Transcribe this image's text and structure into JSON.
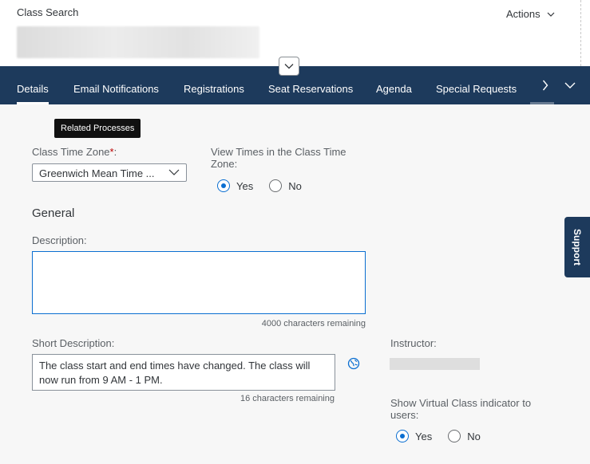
{
  "header": {
    "breadcrumb": "Class Search",
    "actions_label": "Actions"
  },
  "tabs": [
    {
      "label": "Details",
      "active": true
    },
    {
      "label": "Email Notifications"
    },
    {
      "label": "Registrations"
    },
    {
      "label": "Seat Reservations"
    },
    {
      "label": "Agenda"
    },
    {
      "label": "Special Requests"
    }
  ],
  "tooltip": "Related Processes",
  "form": {
    "time_zone": {
      "label": "Class Time Zone",
      "required_mark": "*",
      "colon": ":",
      "value": "Greenwich Mean Time ..."
    },
    "view_times": {
      "label": "View Times in the Class Time Zone:",
      "options": [
        "Yes",
        "No"
      ],
      "selected": "Yes"
    },
    "general_heading": "General",
    "description": {
      "label": "Description:",
      "value": "",
      "counter": "4000 characters remaining"
    },
    "short_description": {
      "label": "Short Description:",
      "value": "The class start and end times have changed. The class will now run from 9 AM - 1 PM.",
      "counter": "16 characters remaining"
    },
    "instructor": {
      "label": "Instructor:"
    },
    "virtual_indicator": {
      "label": "Show Virtual Class indicator to users:",
      "options": [
        "Yes",
        "No"
      ],
      "selected": "Yes"
    }
  },
  "support_label": "Support",
  "colors": {
    "shell": "#1d3a5c",
    "accent": "#0a6ed1",
    "required": "#bb0000"
  }
}
